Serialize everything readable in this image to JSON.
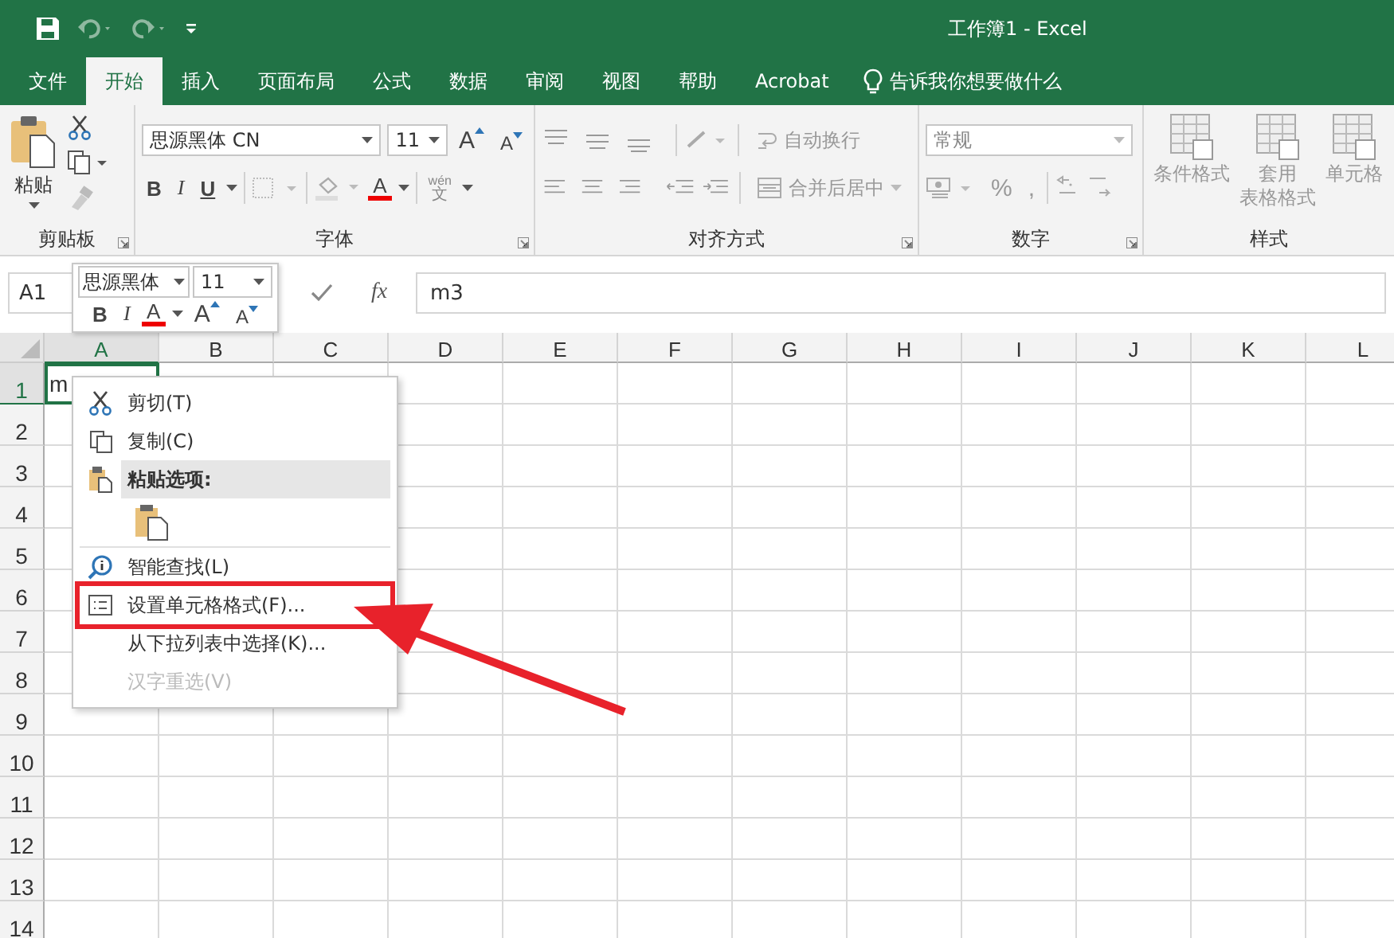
{
  "window": {
    "title": "工作簿1  -  Excel"
  },
  "tabs": [
    {
      "label": "文件",
      "selected": false
    },
    {
      "label": "开始",
      "selected": true
    },
    {
      "label": "插入",
      "selected": false
    },
    {
      "label": "页面布局",
      "selected": false
    },
    {
      "label": "公式",
      "selected": false
    },
    {
      "label": "数据",
      "selected": false
    },
    {
      "label": "审阅",
      "selected": false
    },
    {
      "label": "视图",
      "selected": false
    },
    {
      "label": "帮助",
      "selected": false
    },
    {
      "label": "Acrobat",
      "selected": false
    }
  ],
  "tell_me": {
    "placeholder": "告诉我你想要做什么"
  },
  "ribbon": {
    "clipboard": {
      "label": "剪贴板",
      "paste": "粘贴"
    },
    "font": {
      "label": "字体",
      "font_name": "思源黑体 CN",
      "font_size": "11",
      "grow": "A",
      "shrink": "A",
      "bold": "B",
      "italic": "I",
      "underline": "U",
      "color_button": "A",
      "phonetic_top": "wén",
      "phonetic_bottom": "文"
    },
    "alignment": {
      "label": "对齐方式",
      "wrap": "自动换行",
      "merge": "合并后居中"
    },
    "number": {
      "label": "数字",
      "format": "常规",
      "percent": "%",
      "comma": ","
    },
    "styles": {
      "label": "样式",
      "buttons": [
        {
          "lines": [
            "条件格式"
          ]
        },
        {
          "lines": [
            "套用",
            "表格格式"
          ]
        },
        {
          "lines": [
            "单元格"
          ]
        }
      ]
    }
  },
  "formula_bar": {
    "name_box": "A1",
    "fx": "fx",
    "value": "m3"
  },
  "grid": {
    "columns": [
      "A",
      "B",
      "C",
      "D",
      "E",
      "F",
      "G",
      "H",
      "I",
      "J",
      "K",
      "L"
    ],
    "rows": [
      "1",
      "2",
      "3",
      "4",
      "5",
      "6",
      "7",
      "8",
      "9",
      "10",
      "11",
      "12",
      "13",
      "14"
    ],
    "selected_cell": {
      "text": "m"
    }
  },
  "mini_toolbar": {
    "font_name": "思源黑体",
    "font_size": "11",
    "bold": "B",
    "italic": "I",
    "color_button": "A",
    "grow": "A",
    "shrink": "A"
  },
  "context_menu": [
    {
      "kind": "cut",
      "label": "剪切(T)",
      "disabled": false,
      "annotated": false
    },
    {
      "kind": "copy",
      "label": "复制(C)",
      "disabled": false,
      "annotated": false
    },
    {
      "kind": "header",
      "label": "粘贴选项:"
    },
    {
      "kind": "paste"
    },
    {
      "kind": "lookup",
      "label": "智能查找(L)",
      "disabled": false,
      "annotated": false
    },
    {
      "kind": "format",
      "label": "设置单元格格式(F)...",
      "disabled": false,
      "annotated": true
    },
    {
      "kind": "plain",
      "label": "从下拉列表中选择(K)...",
      "disabled": false,
      "annotated": false
    },
    {
      "kind": "plain",
      "label": "汉字重选(V)",
      "disabled": true,
      "annotated": false
    }
  ]
}
